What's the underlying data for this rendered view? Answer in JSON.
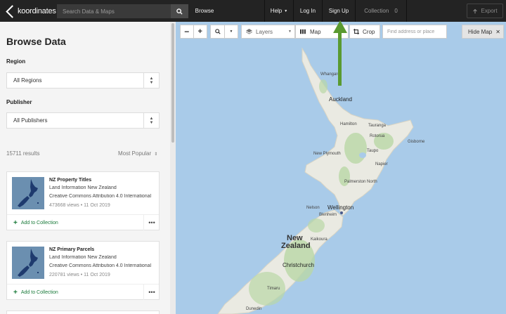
{
  "app": {
    "logo_text": "koordinates",
    "search_placeholder": "Search Data & Maps"
  },
  "nav": {
    "browse": "Browse",
    "help": "Help",
    "login": "Log In",
    "signup": "Sign Up",
    "collection_label": "Collection",
    "collection_count": "0",
    "export": "Export"
  },
  "sidebar": {
    "title": "Browse Data",
    "region_label": "Region",
    "region_value": "All Regions",
    "publisher_label": "Publisher",
    "publisher_value": "All Publishers",
    "results_count": "15711 results",
    "sort_label": "Most Popular",
    "cards": [
      {
        "title": "NZ Property Titles",
        "publisher": "Land Information New Zealand",
        "license": "Creative Commons Attribution 4.0 International",
        "meta": "473668 views • 11 Oct 2019",
        "add_label": "Add to Collection"
      },
      {
        "title": "NZ Primary Parcels",
        "publisher": "Land Information New Zealand",
        "license": "Creative Commons Attribution 4.0 International",
        "meta": "220781 views • 11 Oct 2019",
        "add_label": "Add to Collection"
      }
    ]
  },
  "map_toolbar": {
    "zoom_out": "−",
    "zoom_in": "+",
    "layers": "Layers",
    "map": "Map",
    "crop": "Crop",
    "address_placeholder": "Find address or place",
    "hide_map": "Hide Map"
  },
  "map_labels": {
    "whangarei": "Whangarei",
    "auckland": "Auckland",
    "hamilton": "Hamilton",
    "tauranga": "Tauranga",
    "rotorua": "Rotorua",
    "taupo": "Taupo",
    "gisborne": "Gisborne",
    "new_plymouth": "New Plymouth",
    "napier": "Napier",
    "palmerston_north": "Palmerston North",
    "nelson": "Nelson",
    "wellington": "Wellington",
    "blenheim": "Blenheim",
    "kaikoura": "Kaikoura",
    "new_zealand_1": "New",
    "new_zealand_2": "Zealand",
    "christchurch": "Christchurch",
    "timaru": "Timaru",
    "dunedin": "Dunedin"
  },
  "colors": {
    "topbar": "#232323",
    "water": "#a9cbe9",
    "land": "#eaeae2",
    "forest": "#b9d7a6",
    "accent_green": "#1a7a3a",
    "arrow": "#5a9a30"
  }
}
